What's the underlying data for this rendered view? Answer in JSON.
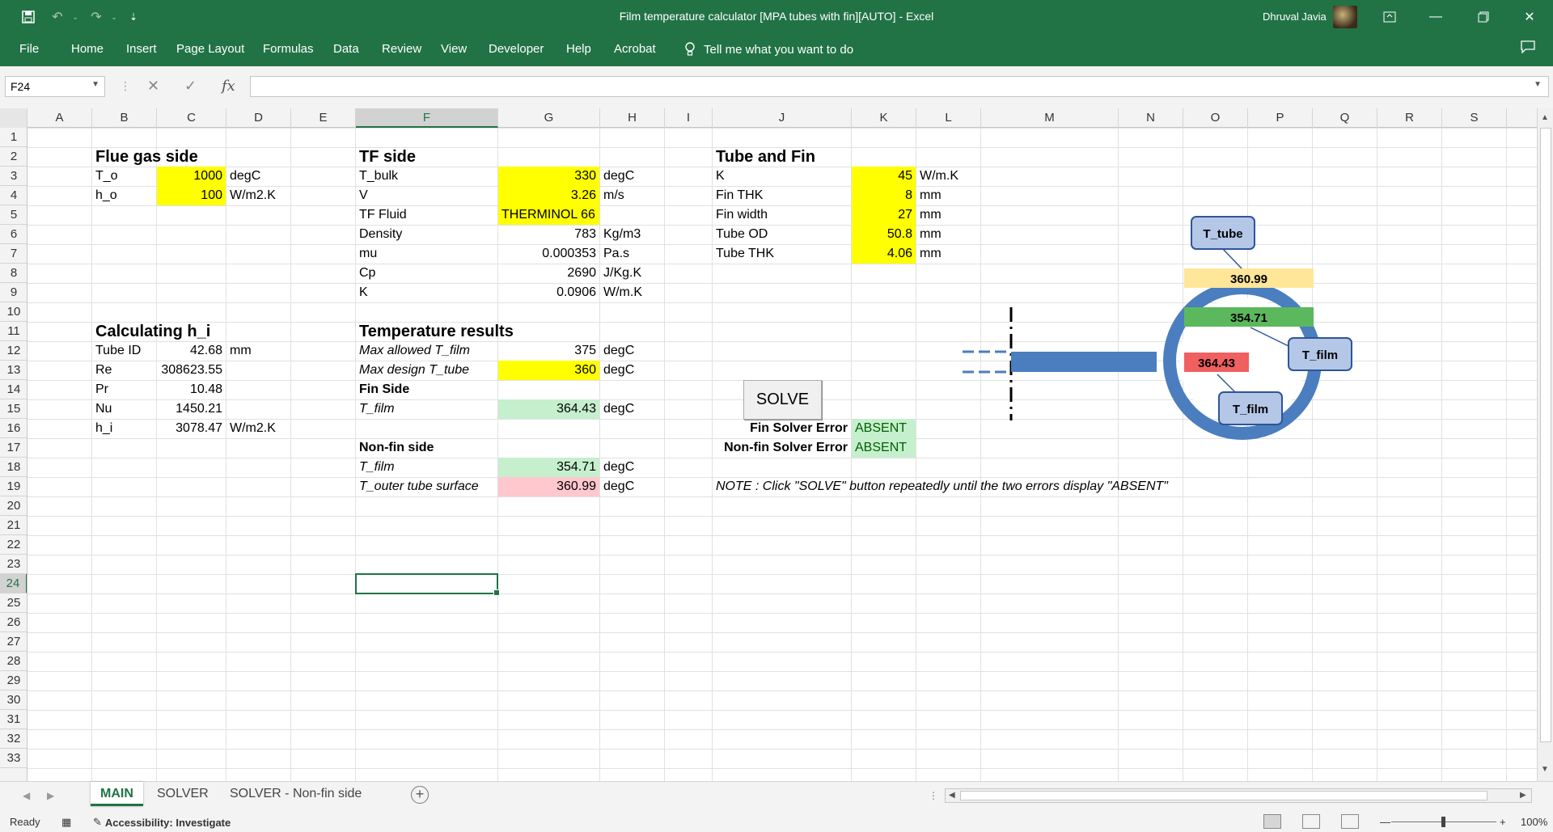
{
  "window": {
    "title": "Film temperature calculator [MPA tubes with fin][AUTO]  -  Excel",
    "user": "Dhruval Javia"
  },
  "ribbon": {
    "tabs": [
      "File",
      "Home",
      "Insert",
      "Page Layout",
      "Formulas",
      "Data",
      "Review",
      "View",
      "Developer",
      "Help",
      "Acrobat"
    ],
    "tell_me": "Tell me what you want to do"
  },
  "formula_bar": {
    "name_box": "F24",
    "fx": "fx",
    "value": ""
  },
  "columns": [
    "A",
    "B",
    "C",
    "D",
    "E",
    "F",
    "G",
    "H",
    "I",
    "J",
    "K",
    "L",
    "M",
    "N",
    "O",
    "P",
    "Q",
    "R",
    "S"
  ],
  "rows": [
    "1",
    "2",
    "3",
    "4",
    "5",
    "6",
    "7",
    "8",
    "9",
    "10",
    "11",
    "12",
    "13",
    "14",
    "15",
    "16",
    "17",
    "18",
    "19",
    "20",
    "21",
    "22",
    "23",
    "24",
    "25",
    "26",
    "27",
    "28",
    "29",
    "30",
    "31",
    "32",
    "33"
  ],
  "flue": {
    "header": "Flue gas side",
    "t_o_label": "T_o",
    "t_o_value": "1000",
    "t_o_unit": "degC",
    "h_o_label": "h_o",
    "h_o_value": "100",
    "h_o_unit": "W/m2.K"
  },
  "hi": {
    "header": "Calculating h_i",
    "tube_id_label": "Tube ID",
    "tube_id_value": "42.68",
    "tube_id_unit": "mm",
    "re_label": "Re",
    "re_value": "308623.55",
    "pr_label": "Pr",
    "pr_value": "10.48",
    "nu_label": "Nu",
    "nu_value": "1450.21",
    "hi_label": "h_i",
    "hi_value": "3078.47",
    "hi_unit": "W/m2.K"
  },
  "tf": {
    "header": "TF side",
    "t_bulk_label": "T_bulk",
    "t_bulk_value": "330",
    "t_bulk_unit": "degC",
    "v_label": "V",
    "v_value": "3.26",
    "v_unit": "m/s",
    "fluid_label": "TF Fluid",
    "fluid_value": "THERMINOL 66",
    "density_label": "Density",
    "density_value": "783",
    "density_unit": "Kg/m3",
    "mu_label": "mu",
    "mu_value": "0.000353",
    "mu_unit": "Pa.s",
    "cp_label": "Cp",
    "cp_value": "2690",
    "cp_unit": "J/Kg.K",
    "k_label": "K",
    "k_value": "0.0906",
    "k_unit": "W/m.K"
  },
  "results": {
    "header": "Temperature results",
    "max_film_label": "Max allowed T_film",
    "max_film_value": "375",
    "max_film_unit": "degC",
    "max_tube_label": "Max design T_tube",
    "max_tube_value": "360",
    "max_tube_unit": "degC",
    "fin_side_label": "Fin Side",
    "fin_tfilm_label": "T_film",
    "fin_tfilm_value": "364.43",
    "fin_tfilm_unit": "degC",
    "nonfin_side_label": "Non-fin side",
    "nonfin_tfilm_label": "T_film",
    "nonfin_tfilm_value": "354.71",
    "nonfin_tfilm_unit": "degC",
    "outer_label": "T_outer tube surface",
    "outer_value": "360.99",
    "outer_unit": "degC"
  },
  "tube": {
    "header": "Tube and Fin",
    "k_label": "K",
    "k_value": "45",
    "k_unit": "W/m.K",
    "fin_thk_label": "Fin THK",
    "fin_thk_value": "8",
    "fin_thk_unit": "mm",
    "fin_width_label": "Fin width",
    "fin_width_value": "27",
    "fin_width_unit": "mm",
    "od_label": "Tube OD",
    "od_value": "50.8",
    "od_unit": "mm",
    "thk_label": "Tube THK",
    "thk_value": "4.06",
    "thk_unit": "mm"
  },
  "solver": {
    "button": "SOLVE",
    "fin_error_label": "Fin Solver Error",
    "fin_error_value": "ABSENT",
    "nonfin_error_label": "Non-fin Solver Error",
    "nonfin_error_value": "ABSENT",
    "note": "NOTE : Click \"SOLVE\" button repeatedly until the two errors display \"ABSENT\""
  },
  "diagram": {
    "t_tube_callout": "T_tube",
    "t_tube_value": "360.99",
    "nonfin_value": "354.71",
    "fin_value": "364.43",
    "t_film_callout_1": "T_film",
    "t_film_callout_2": "T_film",
    "colors": {
      "tube": "#4a7ebf",
      "t_tube_fill": "#ffe699",
      "nonfin_fill": "#5cb85c",
      "fin_fill": "#f06060",
      "callout": "#b4c7e7"
    }
  },
  "sheets": [
    "MAIN",
    "SOLVER",
    "SOLVER - Non-fin side"
  ],
  "active_sheet": "MAIN",
  "status": {
    "ready": "Ready",
    "accessibility": "Accessibility: Investigate",
    "zoom": "100%"
  }
}
